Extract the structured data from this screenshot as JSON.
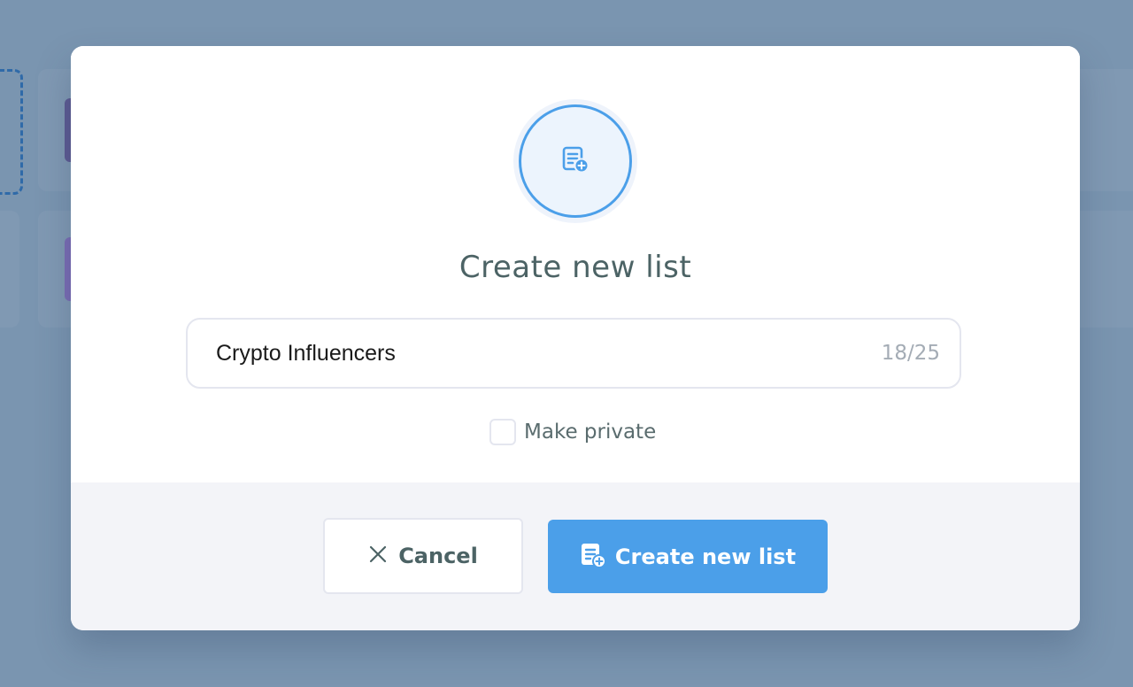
{
  "colors": {
    "accent": "#4b9fe9",
    "overlay": "#7a95b0",
    "title_text": "#4c6365",
    "footer_bg": "#f3f4f8"
  },
  "modal": {
    "header_icon": "list-add-icon",
    "title": "Create new list",
    "list_name": {
      "value": "Crypto Influencers",
      "char_count": "18/25"
    },
    "private_option": {
      "label": "Make private",
      "checked": false
    },
    "footer": {
      "cancel": {
        "icon": "close-icon",
        "label": "Cancel"
      },
      "create": {
        "icon": "list-add-icon",
        "label": "Create new list"
      }
    }
  }
}
